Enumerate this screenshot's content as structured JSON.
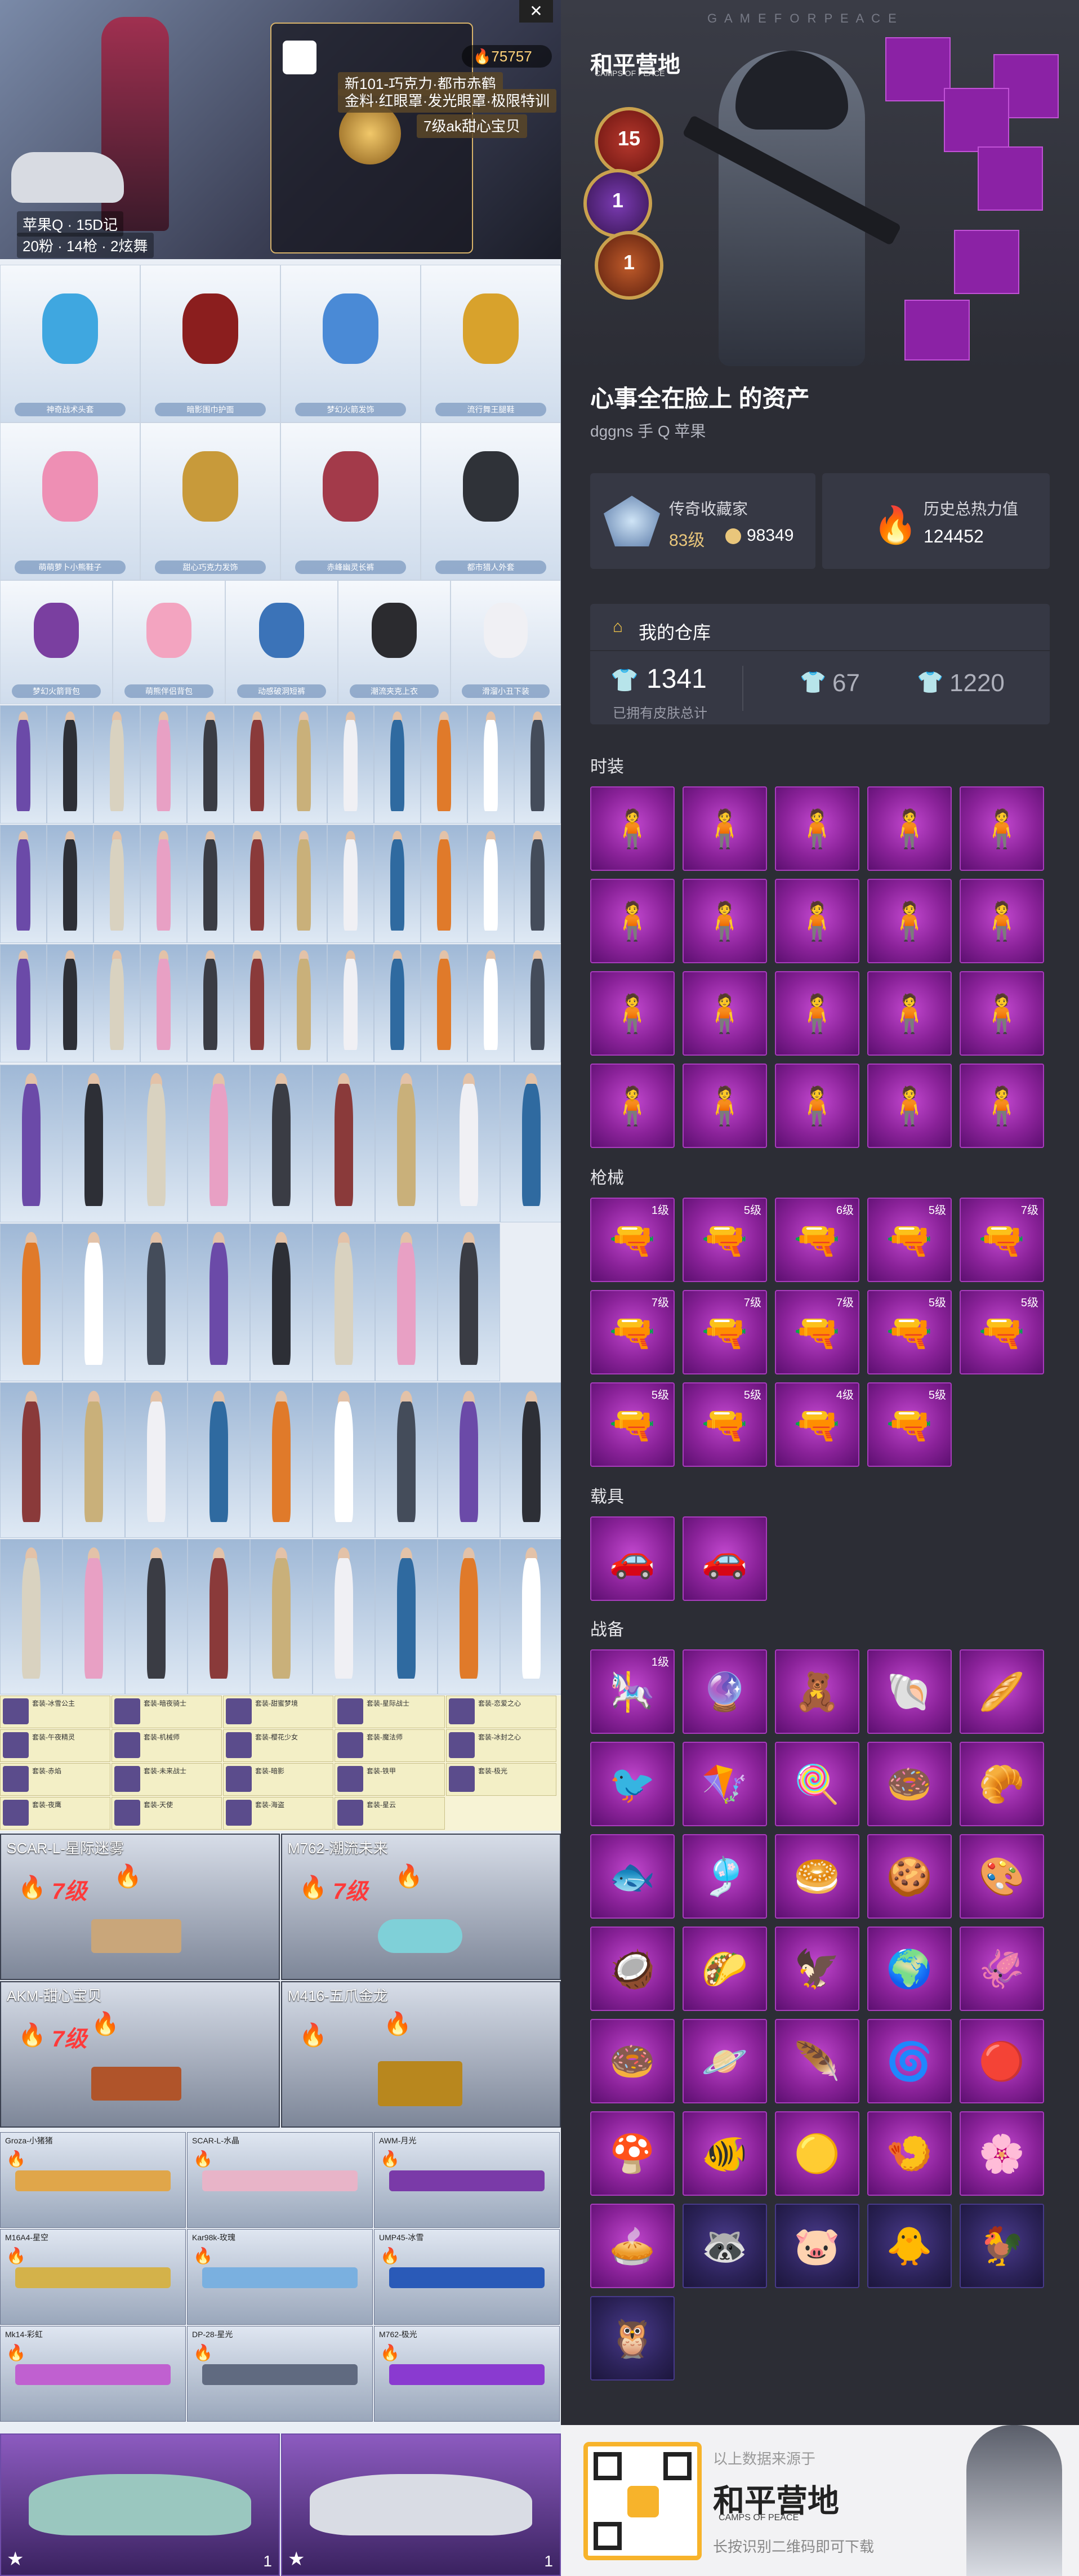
{
  "left": {
    "window_close": "✕",
    "profile": {
      "popularity": "75757",
      "tags": [
        "新101-巧克力·都市赤鹤",
        "金料·红眼罩·发光眼罩·极限特训",
        "7级ak甜心宝贝"
      ],
      "account_line": "苹果Q · 15D记",
      "stats_line": "20粉 · 14枪 · 2炫舞"
    },
    "top_items": [
      "神奇战术头套",
      "暗影围巾护面",
      "梦幻火箭发饰",
      "流行舞王腿鞋",
      "萌萌萝卜小熊鞋子",
      "甜心巧克力发饰",
      "赤峰幽灵长裤",
      "都市猎人外套",
      "梦幻火箭背包",
      "萌熊伴侣背包",
      "动感破洞短裤",
      "潮流夹克上衣",
      "滑溜小丑下装"
    ],
    "gun_cards": [
      {
        "name": "SCAR-L-星际迷雾",
        "level": "7级"
      },
      {
        "name": "M762-潮流未来",
        "level": "7级"
      },
      {
        "name": "AKM-甜心宝贝",
        "level": "7级"
      },
      {
        "name": "M416-五爪金龙",
        "level": ""
      }
    ],
    "small_guns": [
      "Groza-小猪猪",
      "SCAR-L-水晶",
      "AWM-月光",
      "M16A4-星空",
      "Kar98k-玫瑰",
      "UMP45-冰雪",
      "Mk14-彩虹",
      "DP-28-星光",
      "M762-极光"
    ],
    "list_items": [
      "套装-冰雪公主",
      "套装-暗夜骑士",
      "套装-甜蜜梦境",
      "套装-星际战士",
      "套装-恋爱之心",
      "套装-午夜精灵",
      "套装-机械师",
      "套装-樱花少女",
      "套装-魔法师",
      "套装-冰封之心",
      "套装-赤焰",
      "套装-未来战士",
      "套装-暗影",
      "套装-铁甲",
      "套装-极光",
      "套装-夜鹰",
      "套装-天使",
      "套装-海盗",
      "套装-星云"
    ],
    "car_cards": [
      {
        "count": "1"
      },
      {
        "count": "1"
      }
    ]
  },
  "right": {
    "brand": "和平营地",
    "brand_sub": "CAMPS OF PEACE",
    "game_for_peace": "G A M E   F O R   P E A C E",
    "badges": [
      "15",
      "1",
      "1"
    ],
    "title": "心事全在脸上 的资产",
    "subtitle": "dggns  手 Q 苹果",
    "stats": {
      "collector_label": "传奇收藏家",
      "collector_level": "83级",
      "collector_points": "98349",
      "heat_label": "历史总热力值",
      "heat_value": "124452"
    },
    "warehouse": {
      "title": "我的仓库",
      "total": "1341",
      "total_label": "已拥有皮肤总计",
      "count_a": "67",
      "count_b": "1220"
    },
    "sections": {
      "fashion": "时装",
      "weapons": "枪械",
      "vehicles": "载具",
      "gear": "战备"
    },
    "weapon_levels": [
      "1级",
      "5级",
      "6级",
      "5级",
      "7级",
      "7级",
      "7级",
      "7级",
      "5级",
      "5级",
      "5级",
      "5级",
      "4级",
      "5级"
    ],
    "gear_first_level": "1级",
    "footer": {
      "source": "以上数据来源于",
      "brand": "和平营地",
      "brand_sub": "CAMPS OF PEACE",
      "hint": "长按识别二维码即可下载"
    }
  }
}
